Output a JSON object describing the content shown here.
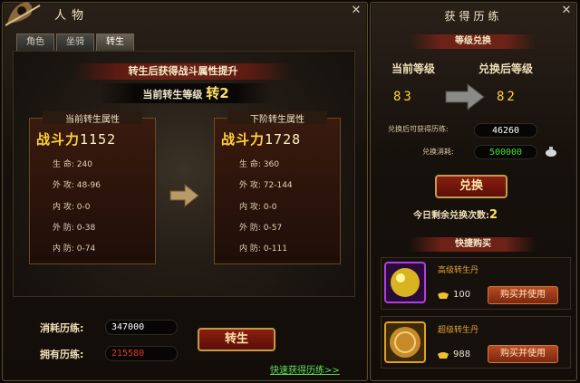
{
  "character_window": {
    "title": "人物",
    "tabs": [
      "角色",
      "坐骑",
      "转生"
    ],
    "active_tab": 2,
    "banner": "转生后获得战斗属性提升",
    "current_rebirth_label": "当前转生等级",
    "current_rebirth_prefix": "转",
    "current_rebirth_value": "2",
    "current_attrs": {
      "header": "当前转生属性",
      "power_label": "战斗力",
      "power_value": "1152",
      "stats": [
        {
          "label": "生 命",
          "value": "240"
        },
        {
          "label": "外 攻",
          "value": "48-96"
        },
        {
          "label": "内 攻",
          "value": "0-0"
        },
        {
          "label": "外 防",
          "value": "0-38"
        },
        {
          "label": "内 防",
          "value": "0-74"
        }
      ]
    },
    "next_attrs": {
      "header": "下阶转生属性",
      "power_label": "战斗力",
      "power_value": "1728",
      "stats": [
        {
          "label": "生 命",
          "value": "360"
        },
        {
          "label": "外 攻",
          "value": "72-144"
        },
        {
          "label": "内 攻",
          "value": "0-0"
        },
        {
          "label": "外 防",
          "value": "0-57"
        },
        {
          "label": "内 防",
          "value": "0-111"
        }
      ]
    },
    "cost_label": "消耗历练:",
    "cost_value": "347000",
    "owned_label": "拥有历练:",
    "owned_value": "215580",
    "rebirth_button": "转生",
    "quick_link": "快速获得历练>>",
    "colors": {
      "owned_value": "#e23a2a",
      "cost_value": "#ffffff",
      "link": "#5ce05c"
    }
  },
  "exchange_window": {
    "title": "获得历练",
    "level_exchange_header": "等级兑换",
    "current_level_label": "当前等级",
    "after_level_label": "兑换后等级",
    "current_level": "83",
    "after_level": "82",
    "gain_label": "兑换后可获得历练:",
    "gain_value": "46260",
    "cost_label": "兑换消耗:",
    "cost_value": "500000",
    "exchange_button": "兑换",
    "remaining_label": "今日剩余兑换次数:",
    "remaining_value": "2",
    "quick_buy_header": "快捷购买",
    "items": [
      {
        "name": "高级转生丹",
        "price": "100",
        "buy_label": "购买并使用",
        "icon": "purple-orb-icon"
      },
      {
        "name": "超级转生丹",
        "price": "988",
        "buy_label": "购买并使用",
        "icon": "golden-disc-icon"
      }
    ],
    "colors": {
      "item_name": "#e2a23a",
      "cost_value": "#38e038"
    }
  }
}
